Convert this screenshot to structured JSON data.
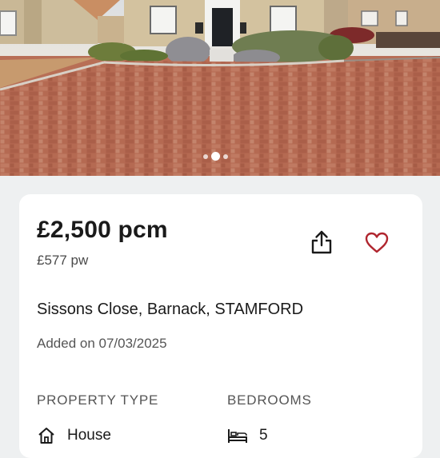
{
  "listing": {
    "price": "£2,500 pcm",
    "price_weekly": "£577 pw",
    "address": "Sissons Close, Barnack, STAMFORD",
    "added": "Added on 07/03/2025",
    "property_type_label": "PROPERTY TYPE",
    "property_type_value": "House",
    "bedrooms_label": "BEDROOMS",
    "bedrooms_value": "5"
  },
  "gallery": {
    "photo": "house-exterior-with-brick-paved-driveway",
    "dots": 3,
    "active_dot": 1
  },
  "icons": {
    "share": "share-icon",
    "favourite": "heart-icon",
    "property_type": "house-icon",
    "bedrooms": "bed-icon"
  },
  "colors": {
    "background": "#eef0f1",
    "card": "#ffffff",
    "heart": "#b0262f",
    "text": "#1a1a1a",
    "muted": "#555555"
  }
}
